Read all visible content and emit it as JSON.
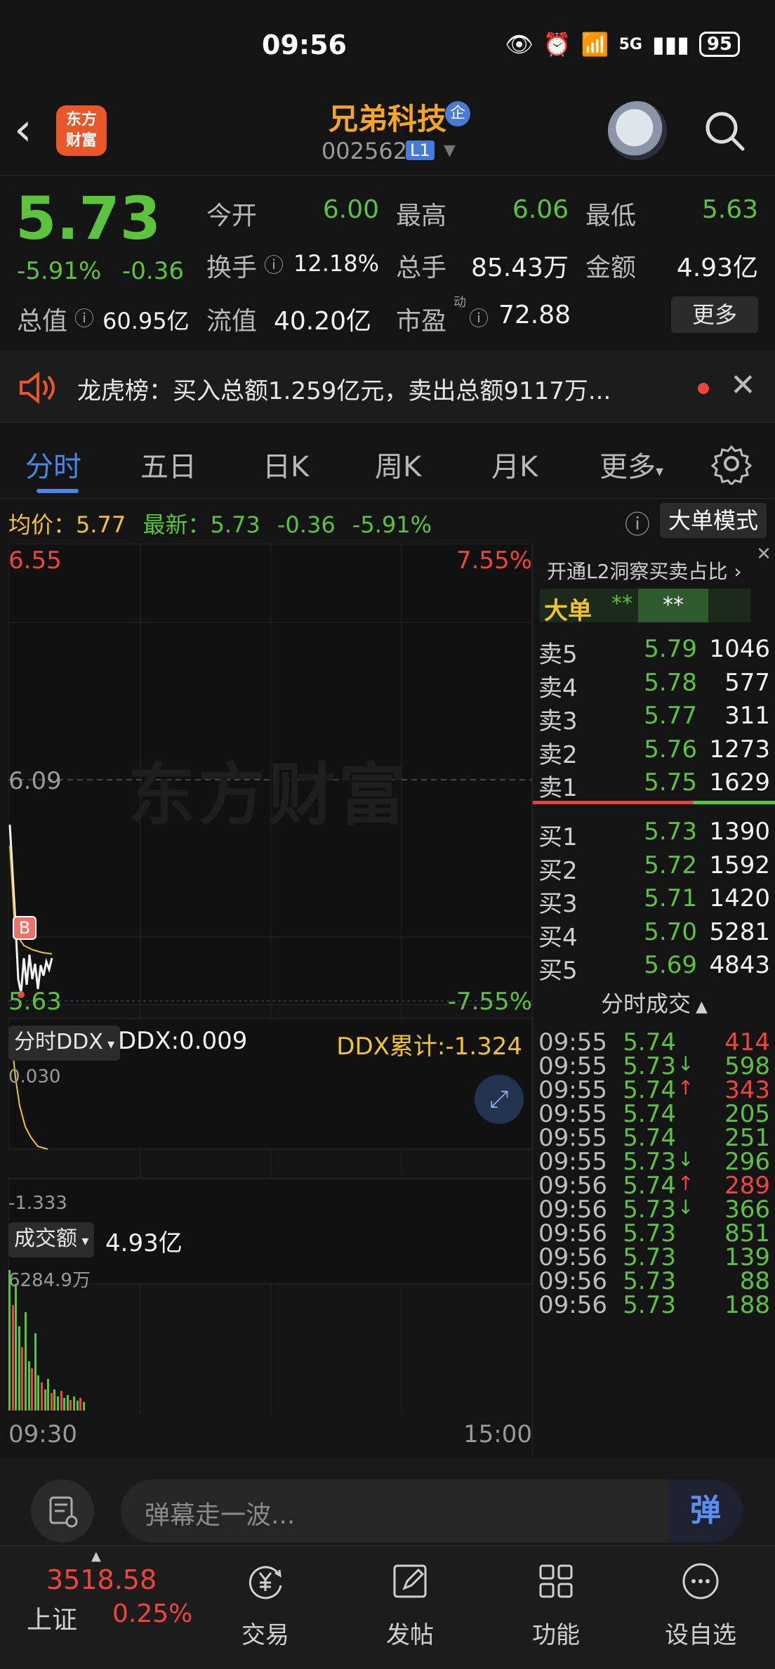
{
  "status_bar": {
    "time": "09:56",
    "network": "5G",
    "battery": "95"
  },
  "header": {
    "stock_name": "兄弟科技",
    "badge_qi": "企",
    "stock_code": "002562",
    "level_badge": "L1",
    "logo_text_1": "东方",
    "logo_text_2": "财富"
  },
  "quote": {
    "price": "5.73",
    "change_pct": "-5.91%",
    "change_val": "-0.36",
    "open_label": "今开",
    "open_value": "6.00",
    "high_label": "最高",
    "high_value": "6.06",
    "low_label": "最低",
    "low_value": "5.63",
    "turnover_label": "换手",
    "turnover_value": "12.18%",
    "volume_label": "总手",
    "volume_value": "85.43万",
    "amount_label": "金额",
    "amount_value": "4.93亿",
    "mktcap_label": "总值",
    "mktcap_value": "60.95亿",
    "float_label": "流值",
    "float_value": "40.20亿",
    "pe_label": "市盈",
    "pe_sup": "动",
    "pe_value": "72.88",
    "more_label": "更多"
  },
  "ticker": {
    "text": "龙虎榜：买入总额1.259亿元，卖出总额9117万..."
  },
  "tabs": [
    "分时",
    "五日",
    "日K",
    "周K",
    "月K",
    "更多"
  ],
  "avg_row": {
    "avg_label": "均价：",
    "avg_value": "5.77",
    "latest_label": "最新：",
    "latest_value": "5.73",
    "latest_change": "-0.36",
    "latest_pct": "-5.91%",
    "big_order_btn": "大单模式"
  },
  "price_chart": {
    "top_price": "6.55",
    "top_pct": "7.55%",
    "mid_price": "6.09",
    "bottom_price": "5.63",
    "bottom_pct": "-7.55%",
    "watermark": "东方财富",
    "marker_b": "B"
  },
  "ddx": {
    "selector": "分时DDX",
    "ddx_value": "DDX:0.009",
    "ddx_cum": "DDX累计:-1.324",
    "axis_top": "0.030",
    "axis_bottom": "-1.333"
  },
  "volume": {
    "selector": "成交额",
    "total": "4.93亿",
    "axis_top": "6284.9万",
    "time_start": "09:30",
    "time_end": "15:00"
  },
  "order_book": {
    "l2_promo": "开通L2洞察买卖占比",
    "big_order_label": "大单",
    "big_order_v1": "**",
    "big_order_v2": "**",
    "asks": [
      {
        "label": "卖5",
        "price": "5.79",
        "vol": "1046"
      },
      {
        "label": "卖4",
        "price": "5.78",
        "vol": "577"
      },
      {
        "label": "卖3",
        "price": "5.77",
        "vol": "311"
      },
      {
        "label": "卖2",
        "price": "5.76",
        "vol": "1273"
      },
      {
        "label": "卖1",
        "price": "5.75",
        "vol": "1629"
      }
    ],
    "bids": [
      {
        "label": "买1",
        "price": "5.73",
        "vol": "1390"
      },
      {
        "label": "买2",
        "price": "5.72",
        "vol": "1592"
      },
      {
        "label": "买3",
        "price": "5.71",
        "vol": "1420"
      },
      {
        "label": "买4",
        "price": "5.70",
        "vol": "5281"
      },
      {
        "label": "买5",
        "price": "5.69",
        "vol": "4843"
      }
    ],
    "ticks_title": "分时成交",
    "ticks": [
      {
        "time": "09:55",
        "price": "5.74",
        "arrow": "",
        "vol": "414",
        "vol_color": "#f0443c"
      },
      {
        "time": "09:55",
        "price": "5.73",
        "arrow": "↓",
        "vol": "598",
        "vol_color": "#5cc43c"
      },
      {
        "time": "09:55",
        "price": "5.74",
        "arrow": "↑",
        "vol": "343",
        "vol_color": "#f0443c"
      },
      {
        "time": "09:55",
        "price": "5.74",
        "arrow": "",
        "vol": "205",
        "vol_color": "#5cc43c"
      },
      {
        "time": "09:55",
        "price": "5.74",
        "arrow": "",
        "vol": "251",
        "vol_color": "#5cc43c"
      },
      {
        "time": "09:55",
        "price": "5.73",
        "arrow": "↓",
        "vol": "296",
        "vol_color": "#5cc43c"
      },
      {
        "time": "09:56",
        "price": "5.74",
        "arrow": "↑",
        "vol": "289",
        "vol_color": "#f0443c"
      },
      {
        "time": "09:56",
        "price": "5.73",
        "arrow": "↓",
        "vol": "366",
        "vol_color": "#5cc43c"
      },
      {
        "time": "09:56",
        "price": "5.73",
        "arrow": "",
        "vol": "851",
        "vol_color": "#5cc43c"
      },
      {
        "time": "09:56",
        "price": "5.73",
        "arrow": "",
        "vol": "139",
        "vol_color": "#5cc43c"
      },
      {
        "time": "09:56",
        "price": "5.73",
        "arrow": "",
        "vol": "88",
        "vol_color": "#5cc43c"
      },
      {
        "time": "09:56",
        "price": "5.73",
        "arrow": "",
        "vol": "188",
        "vol_color": "#5cc43c"
      }
    ]
  },
  "danmaku": {
    "placeholder": "弹幕走一波...",
    "send_label": "弹"
  },
  "nav": {
    "index_value": "3518.58",
    "index_name": "上证",
    "index_pct": "0.25%",
    "items": [
      "交易",
      "发帖",
      "功能",
      "设自选"
    ]
  },
  "colors": {
    "up": "#f0443c",
    "down": "#5cc43c",
    "accent": "#4a86e8",
    "brand": "#f6a623"
  }
}
